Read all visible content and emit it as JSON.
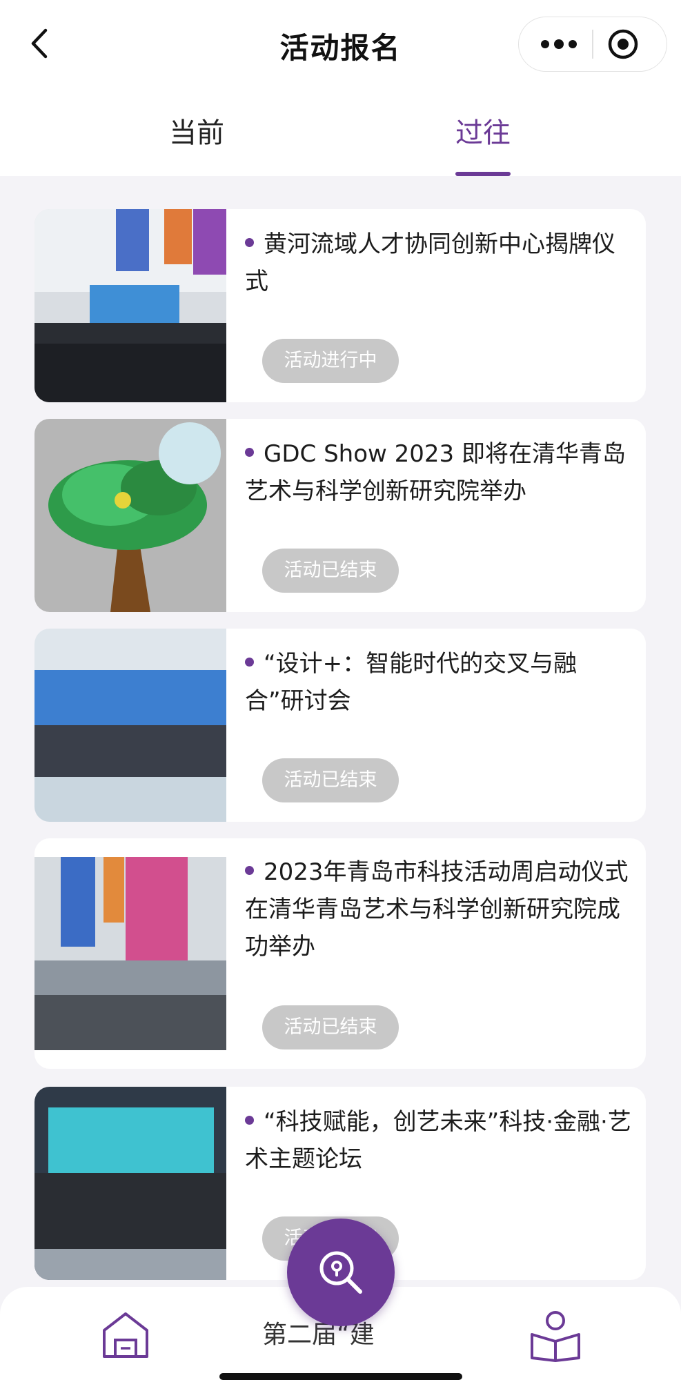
{
  "header": {
    "title": "活动报名"
  },
  "tabs": [
    {
      "label": "当前"
    },
    {
      "label": "过往"
    }
  ],
  "events": [
    {
      "title": "黄河流域人才协同创新中心揭牌仪式",
      "status": "活动进行中",
      "image": "venue-ceremony-photo"
    },
    {
      "title": "GDC Show 2023 即将在清华青岛艺术与科学创新研究院举办",
      "status": "活动已结束",
      "image": "3d-tree-render"
    },
    {
      "title": "“设计+：智能时代的交叉与融合”研讨会",
      "status": "活动已结束",
      "image": "group-photo-stage"
    },
    {
      "title": "2023年青岛市科技活动周启动仪式在清华青岛艺术与科学创新研究院成功举办",
      "status": "活动已结束",
      "image": "hall-with-banners"
    },
    {
      "title": "“科技赋能，创艺未来”科技·金融·艺术主题论坛",
      "status": "活动已结束",
      "image": "group-photo-blue-screen"
    }
  ],
  "bottom_peek_text": "第二届“建",
  "colors": {
    "accent": "#6b3a96",
    "status_bg": "#c8c8c8",
    "page_bg": "#f4f3f7"
  },
  "icons": {
    "fab": "search-location-icon",
    "home": "home-icon",
    "reader": "reader-icon"
  }
}
